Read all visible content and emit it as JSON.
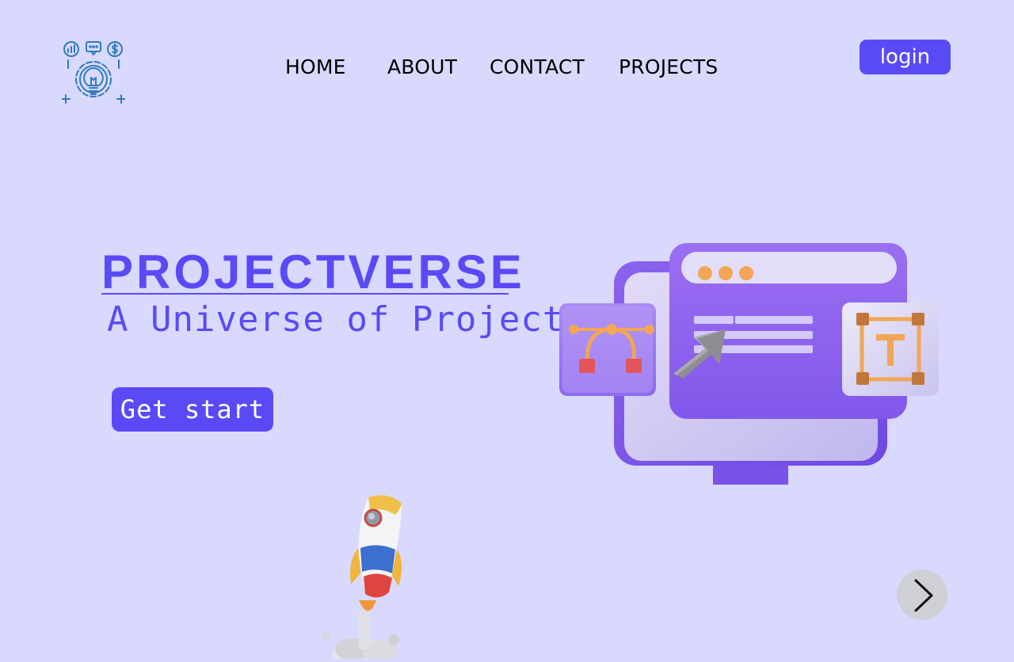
{
  "nav": {
    "items": [
      {
        "label": "HOME"
      },
      {
        "label": "ABOUT"
      },
      {
        "label": "CONTACT"
      },
      {
        "label": "PROJECTS"
      }
    ],
    "login_label": "login"
  },
  "hero": {
    "title": "PROJECTVERSE",
    "subtitle": "A Universe of Project",
    "cta_label": "Get start"
  },
  "icons": {
    "logo": "gear-lightbulb-icon",
    "next": "chevron-right-icon"
  },
  "colors": {
    "background": "#d9d9fe",
    "accent": "#5a4af6",
    "text": "#000000",
    "logo": "#2f7bbd"
  }
}
